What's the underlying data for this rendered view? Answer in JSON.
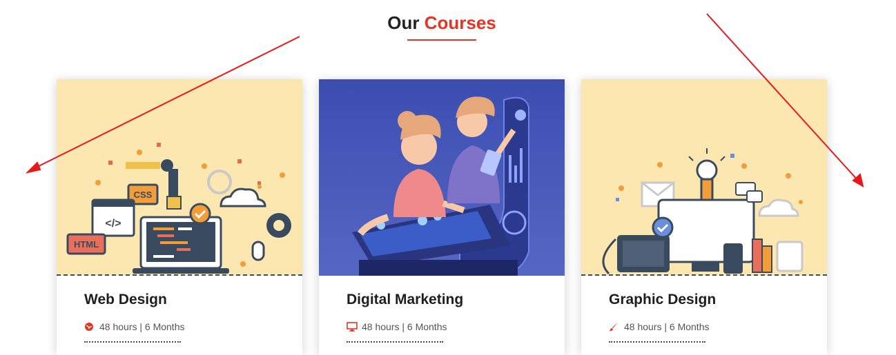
{
  "section": {
    "title_prefix": "Our",
    "title_accent": "Courses"
  },
  "colors": {
    "accent": "#e63323",
    "card_bg_warm": "#fde7b0",
    "card_bg_blue": "#3f55b5"
  },
  "courses": [
    {
      "name": "Web Design",
      "meta": "48 hours | 6 Months",
      "icon": "globe-icon",
      "art_labels": {
        "css": "CSS",
        "html": "HTML",
        "code": "</>"
      }
    },
    {
      "name": "Digital Marketing",
      "meta": "48 hours | 6 Months",
      "icon": "monitor-icon"
    },
    {
      "name": "Graphic Design",
      "meta": "48 hours | 6 Months",
      "icon": "brush-icon"
    }
  ]
}
